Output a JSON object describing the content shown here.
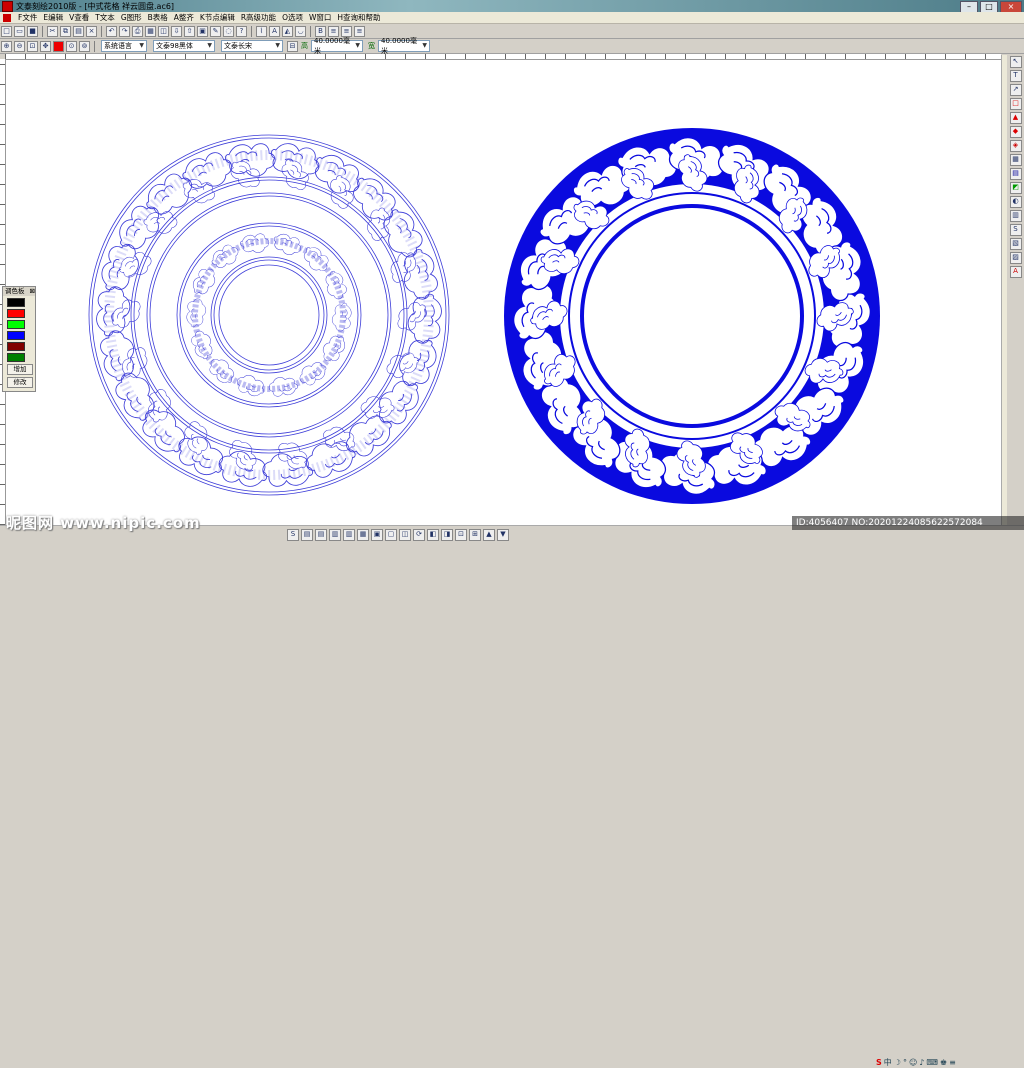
{
  "window": {
    "title": "文泰刻绘2010版 - [中式花格  祥云圆盘.ac6]"
  },
  "menus": [
    "F文件",
    "E编辑",
    "V查看",
    "T文本",
    "G图形",
    "B表格",
    "A整齐",
    "K节点编辑",
    "R高级功能",
    "O选项",
    "W窗口",
    "H查询和帮助"
  ],
  "toolbar2": {
    "lang_combo": "系统语言",
    "font_combo": "文泰98黑体",
    "style_combo": "文泰长宋",
    "height_label": "高",
    "height_value": "40.0000毫米",
    "width_label": "宽",
    "width_value": "40.0000毫米"
  },
  "palette": {
    "title": "调色板",
    "colors": [
      "#000000",
      "#ff0000",
      "#00ff00",
      "#0000ff",
      "#800000",
      "#008000"
    ],
    "add_label": "增加",
    "modify_label": "修改"
  },
  "watermark": {
    "left": "昵图网 www.nipic.com",
    "right": "ID:4056407 NO:20201224085622572084"
  },
  "colors": {
    "pattern_outline": "#3c3cd8",
    "pattern_fill": "#0a0adf"
  },
  "icons": [
    "new-icon",
    "open-icon",
    "save-icon",
    "cut-icon",
    "copy-icon",
    "paste-icon",
    "undo-icon",
    "redo-icon",
    "print-icon",
    "zoom-in-icon",
    "zoom-out-icon",
    "pointer-icon",
    "text-tool-icon",
    "rectangle-icon",
    "fill-icon",
    "grid-icon"
  ]
}
